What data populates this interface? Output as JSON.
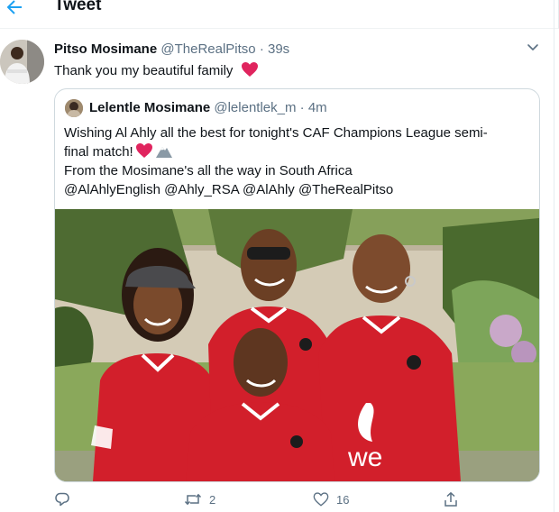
{
  "header": {
    "title": "Tweet"
  },
  "tweet": {
    "author_name": "Pitso Mosimane",
    "author_handle": "@TheRealPitso",
    "separator": "·",
    "time": "39s",
    "text": "Thank you my beautiful family",
    "text_emoji": "heart-icon"
  },
  "quote": {
    "author_name": "Lelentle Mosimane",
    "author_handle": "@lelentlek_m",
    "separator": "·",
    "time": "4m",
    "lines": [
      "Wishing Al Ahly all the best for tonight's CAF Champions League semi-",
      "final match!",
      "From the Mosimane's all the way in South Africa",
      "@AlAhlyEnglish @Ahly_RSA @AlAhly @TheRealPitso"
    ],
    "photo_alt": "Family photo in red Al Ahly jerseys"
  },
  "actions": {
    "reply_count": "",
    "retweet_count": "2",
    "like_count": "16"
  },
  "colors": {
    "secondary_text": "#5b7083",
    "accent": "#1da1f2",
    "heart": "#e0245e",
    "jersey_red": "#d21f2b",
    "border": "#cfd9de"
  }
}
